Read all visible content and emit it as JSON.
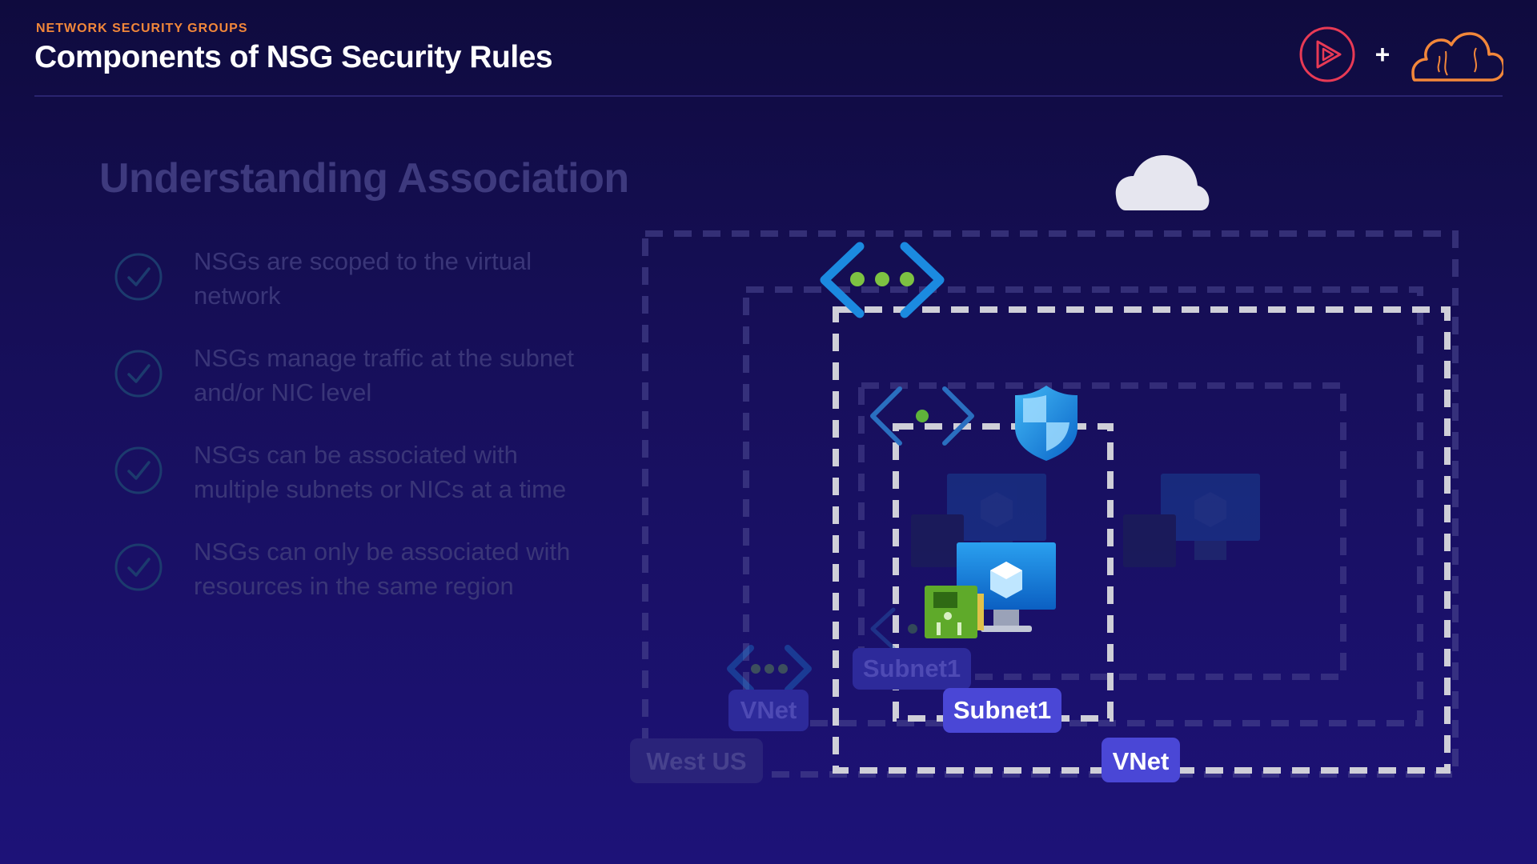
{
  "header": {
    "kicker": "NETWORK SECURITY GROUPS",
    "title": "Components of NSG Security Rules"
  },
  "logos": {
    "left_icon": "play-circle-icon",
    "separator": "+",
    "right_icon": "cloud-guru-icon"
  },
  "section": {
    "title": "Understanding Association"
  },
  "bullets": [
    {
      "icon": "check-circle-icon",
      "line1": "NSGs are scoped to the virtual",
      "line2": "network"
    },
    {
      "icon": "check-circle-icon",
      "line1": "NSGs manage traffic at the subnet",
      "line2": "and/or NIC level"
    },
    {
      "icon": "check-circle-icon",
      "line1": "NSGs can be associated with",
      "line2": "multiple subnets or NICs at a time"
    },
    {
      "icon": "check-circle-icon",
      "line1": "NSGs can only be associated with",
      "line2": "resources in the same region"
    }
  ],
  "diagram": {
    "region_label": "West US",
    "vnet_label_faded": "VNet",
    "subnet_label_faded": "Subnet1",
    "subnet_label": "Subnet1",
    "vnet_label": "VNet",
    "icons": [
      "cloud-icon",
      "vnet-icon",
      "subnet-icon",
      "nsg-shield-icon",
      "virtual-machine-icon",
      "nic-icon"
    ]
  },
  "colors": {
    "accent_orange": "#f2873a",
    "accent_red": "#e83a55",
    "label_blue": "#4a47d6",
    "azure_blue": "#1b8ae0",
    "dashed_border": "#cfcfd8"
  }
}
